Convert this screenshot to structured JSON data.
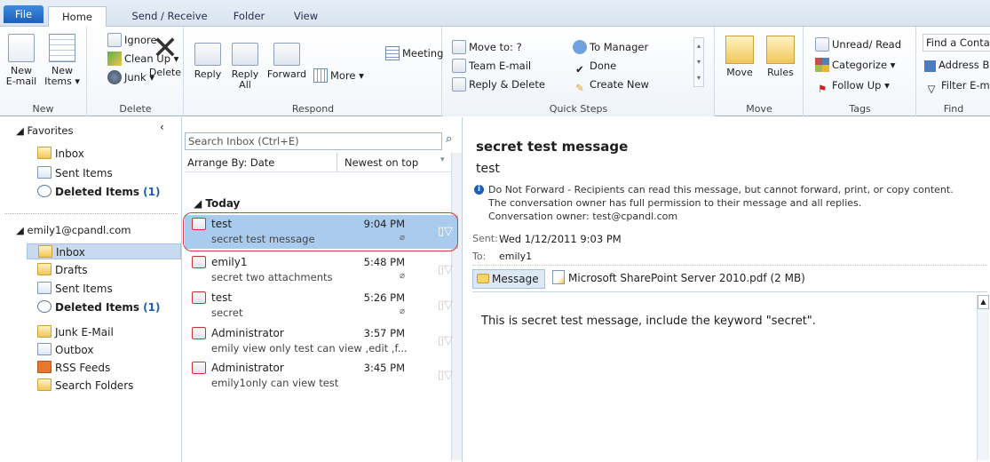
{
  "tabs": [
    "File",
    "Home",
    "Send / Receive",
    "Folder",
    "View"
  ],
  "ribbon": {
    "new": {
      "new_email": "New",
      "new_email2": "E-mail",
      "new_items": "New",
      "new_items2": "Items ▾",
      "label": "New"
    },
    "delete": {
      "ignore": "Ignore",
      "cleanup": "Clean Up ▾",
      "junk": "Junk ▾",
      "delete": "Delete",
      "label": "Delete"
    },
    "respond": {
      "reply": "Reply",
      "reply_all": "Reply",
      "reply_all2": "All",
      "forward": "Forward",
      "meeting": "Meeting",
      "more": "More ▾",
      "label": "Respond"
    },
    "quicksteps": {
      "move_to": "Move to: ?",
      "team_email": "Team E-mail",
      "reply_delete": "Reply & Delete",
      "to_manager": "To Manager",
      "done": "Done",
      "create_new": "Create New",
      "label": "Quick Steps"
    },
    "move": {
      "move": "Move",
      "rules": "Rules",
      "label": "Move"
    },
    "tags": {
      "unread": "Unread/ Read",
      "categorize": "Categorize ▾",
      "follow_up": "Follow Up ▾",
      "label": "Tags"
    },
    "find": {
      "find_contact": "Find a Conta",
      "address_book": "Address B",
      "filter": "Filter E-m",
      "label": "Find"
    }
  },
  "folders": {
    "favorites": "◢ Favorites",
    "fav_items": [
      {
        "name": "Inbox",
        "count": ""
      },
      {
        "name": "Sent Items",
        "count": ""
      },
      {
        "name": "Deleted Items",
        "count": "(1)"
      }
    ],
    "account": "◢ emily1@cpandl.com",
    "acct_items": [
      {
        "name": "Inbox",
        "count": ""
      },
      {
        "name": "Drafts",
        "count": ""
      },
      {
        "name": "Sent Items",
        "count": ""
      },
      {
        "name": "Deleted Items",
        "count": "(1)"
      },
      {
        "name": "Junk E-Mail",
        "count": ""
      },
      {
        "name": "Outbox",
        "count": ""
      },
      {
        "name": "RSS Feeds",
        "count": ""
      },
      {
        "name": "Search Folders",
        "count": ""
      }
    ]
  },
  "list": {
    "search_placeholder": "Search Inbox (Ctrl+E)",
    "arrange": "Arrange By: Date",
    "order": "Newest on top",
    "group": "◢  Today",
    "messages": [
      {
        "from": "test",
        "subject": "secret test message",
        "time": "9:04 PM"
      },
      {
        "from": "emily1",
        "subject": "secret two attachments",
        "time": "5:48 PM"
      },
      {
        "from": "test",
        "subject": "secret",
        "time": "5:26 PM"
      },
      {
        "from": "Administrator",
        "subject": "emily view only test can view ,edit ,f...",
        "time": "3:57 PM"
      },
      {
        "from": "Administrator",
        "subject": "emily1only can view test",
        "time": "3:45 PM"
      }
    ]
  },
  "reading": {
    "title": "secret test message",
    "from": "test",
    "notice1": "Do Not Forward - Recipients can read this message, but cannot forward, print, or copy content.",
    "notice2": "The conversation owner has full permission to their message and all replies.",
    "notice3": "Conversation owner: test@cpandl.com",
    "sent_label": "Sent:",
    "sent_value": "Wed 1/12/2011 9:03 PM",
    "to_label": "To:",
    "to_value": "emily1",
    "tab_message": "Message",
    "attachment": "Microsoft SharePoint Server 2010.pdf (2 MB)",
    "body": "This is secret test message, include the keyword \"secret\"."
  },
  "colors": {
    "accent": "#1d5fb6",
    "selected": "#a9ccee",
    "highlight_border": "#e03b3b"
  }
}
